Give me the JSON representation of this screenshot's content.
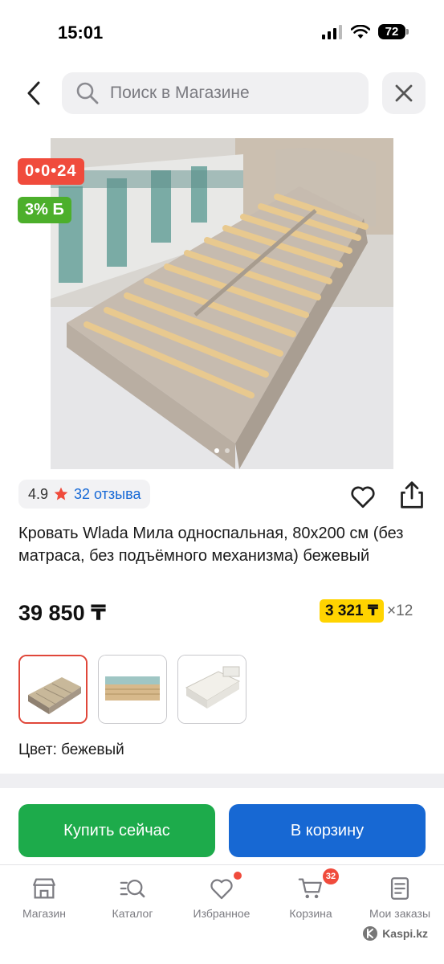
{
  "status_bar": {
    "time": "15:01",
    "battery": "72"
  },
  "search": {
    "placeholder": "Поиск в Магазине"
  },
  "badges": {
    "timer": "0•0•24",
    "cashback": "3% Б"
  },
  "product": {
    "rating": "4.9",
    "reviews": "32 отзыва",
    "title": "Кровать Wlada Мила односпальная, 80x200 см (без матраса, без подъёмного механизма) бежевый",
    "price": "39 850 ₸",
    "installment_amount": "3 321 ₸",
    "installment_months": "×12",
    "color_label": "Цвет: бежевый"
  },
  "actions": {
    "buy_now": "Купить сейчас",
    "add_to_cart": "В корзину"
  },
  "tabs": [
    {
      "label": "Магазин",
      "icon": "store-icon"
    },
    {
      "label": "Каталог",
      "icon": "catalog-search-icon"
    },
    {
      "label": "Избранное",
      "icon": "heart-icon"
    },
    {
      "label": "Корзина",
      "icon": "cart-icon",
      "badge": "32"
    },
    {
      "label": "Мои заказы",
      "icon": "orders-icon"
    }
  ],
  "watermark": "Kaspi.kz",
  "colors": {
    "accent_red": "#f04b3c",
    "buy_green": "#1dab4b",
    "cart_blue": "#1768d3",
    "installment_yellow": "#ffd400"
  }
}
